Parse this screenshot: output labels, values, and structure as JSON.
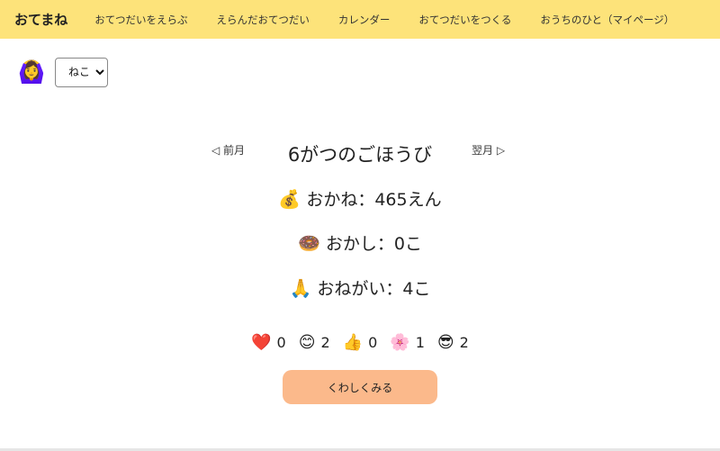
{
  "navbar": {
    "brand": "おてまね",
    "items": [
      "おてつだいをえらぶ",
      "えらんだおてつだい",
      "カレンダー",
      "おてつだいをつくる",
      "おうちのひと（マイページ）"
    ]
  },
  "user": {
    "avatar_icon": "🙆‍♀️",
    "avatar_name": "girl-icon",
    "selected": "ねこ"
  },
  "month": {
    "prev_label": "◁ 前月",
    "next_label": "翌月 ▷",
    "title": "6がつのごほうび"
  },
  "rewards": [
    {
      "icon": "💰",
      "text": "おかね：465えん"
    },
    {
      "icon": "🍩",
      "text": "おかし：0こ"
    },
    {
      "icon": "🙏",
      "text": "おねがい：4こ"
    }
  ],
  "reactions": [
    {
      "icon": "❤️",
      "name": "heart",
      "count": "0"
    },
    {
      "icon": "😊",
      "name": "smile",
      "count": "2"
    },
    {
      "icon": "👍",
      "name": "thumbs-up",
      "count": "0"
    },
    {
      "icon": "🌸",
      "name": "flower",
      "count": "1"
    },
    {
      "icon": "😎",
      "name": "sunglasses",
      "count": "2"
    }
  ],
  "detail_button": "くわしくみる"
}
